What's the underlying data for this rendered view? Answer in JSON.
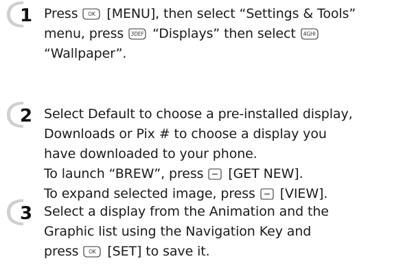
{
  "steps": [
    {
      "number": "1",
      "lines": [
        {
          "a": "Press ",
          "key": "OK",
          "b": " [MENU], then select “Settings & Tools”"
        },
        {
          "a": "menu, press ",
          "key": "3DEF",
          "b": " “Displays” then select ",
          "key2": "4GHI"
        },
        {
          "a": "“Wallpaper”."
        }
      ]
    },
    {
      "number": "2",
      "lines": [
        {
          "a": "Select Default to choose a pre-installed display,"
        },
        {
          "a": "Downloads or Pix # to choose a display you"
        },
        {
          "a": "have downloaded to your phone."
        },
        {
          "a": "To launch “BREW”, press ",
          "key": "right-soft-key",
          "b": " [GET NEW]."
        },
        {
          "a": "To expand selected image, press ",
          "key": "left-soft-key",
          "b": " [VIEW]."
        }
      ]
    },
    {
      "number": "3",
      "lines": [
        {
          "a": "Select a display from the Animation and the"
        },
        {
          "a": "Graphic list using the Navigation Key and"
        },
        {
          "a": "press ",
          "key": "OK",
          "b": " [SET] to save it."
        }
      ]
    }
  ],
  "colors": {
    "text": "#1a1a1a",
    "badge_fill": "#cfcfcf",
    "badge_number": "#111111"
  }
}
